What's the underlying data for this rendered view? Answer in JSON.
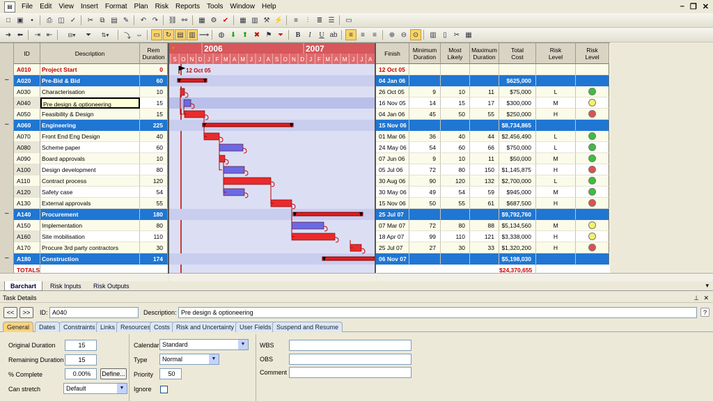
{
  "menu": [
    "File",
    "Edit",
    "View",
    "Insert",
    "Format",
    "Plan",
    "Risk",
    "Reports",
    "Tools",
    "Window",
    "Help"
  ],
  "grid_headers": {
    "id": "ID",
    "description": "Description",
    "rem_duration": "Rem\nDuration",
    "finish": "Finish",
    "min_duration": "Minimum\nDuration",
    "most_likely": "Most\nLikely",
    "max_duration": "Maximum\nDuration",
    "total_cost": "Total\nCost",
    "risk_level": "Risk\nLevel",
    "risk_level2": "Risk\nLevel"
  },
  "timeline": {
    "years": [
      "2006",
      "2007"
    ],
    "months": [
      "S",
      "O",
      "N",
      "D",
      "J",
      "F",
      "M",
      "A",
      "M",
      "J",
      "J",
      "A",
      "S",
      "O",
      "N",
      "D",
      "J",
      "F",
      "M",
      "A",
      "M",
      "J",
      "J",
      "A"
    ],
    "start_marker": "12 Oct 05"
  },
  "rows": [
    {
      "id": "A010",
      "desc": "Project Start",
      "dur": "0",
      "finish": "12 Oct 05",
      "min": "",
      "ml": "",
      "max": "",
      "cost": "",
      "risk": "",
      "dot": "",
      "type": "milestone"
    },
    {
      "id": "A020",
      "desc": "Pre-Bid & Bid",
      "dur": "60",
      "finish": "04 Jan 06",
      "min": "",
      "ml": "",
      "max": "",
      "cost": "$625,000",
      "risk": "",
      "dot": "",
      "type": "summary"
    },
    {
      "id": "A030",
      "desc": "Characterisation",
      "dur": "10",
      "finish": "26 Oct 05",
      "min": "9",
      "ml": "10",
      "max": "11",
      "cost": "$75,000",
      "risk": "L",
      "dot": "#3cbf3c",
      "type": "task"
    },
    {
      "id": "A040",
      "desc": "Pre design & optioneering",
      "dur": "15",
      "finish": "16 Nov 05",
      "min": "14",
      "ml": "15",
      "max": "17",
      "cost": "$300,000",
      "risk": "M",
      "dot": "#f2f26a",
      "type": "task"
    },
    {
      "id": "A050",
      "desc": "Feasibility & Design",
      "dur": "15",
      "finish": "04 Jan 06",
      "min": "45",
      "ml": "50",
      "max": "55",
      "cost": "$250,000",
      "risk": "H",
      "dot": "#e05050",
      "type": "task"
    },
    {
      "id": "A060",
      "desc": "Engineering",
      "dur": "225",
      "finish": "15 Nov 06",
      "min": "",
      "ml": "",
      "max": "",
      "cost": "$8,734,865",
      "risk": "",
      "dot": "",
      "type": "summary"
    },
    {
      "id": "A070",
      "desc": "Front End Eng Design",
      "dur": "40",
      "finish": "01 Mar 06",
      "min": "36",
      "ml": "40",
      "max": "44",
      "cost": "$2,456,490",
      "risk": "L",
      "dot": "#3cbf3c",
      "type": "task"
    },
    {
      "id": "A080",
      "desc": "Scheme paper",
      "dur": "60",
      "finish": "24 May 06",
      "min": "54",
      "ml": "60",
      "max": "66",
      "cost": "$750,000",
      "risk": "L",
      "dot": "#3cbf3c",
      "type": "task"
    },
    {
      "id": "A090",
      "desc": "Board approvals",
      "dur": "10",
      "finish": "07 Jun 06",
      "min": "9",
      "ml": "10",
      "max": "11",
      "cost": "$50,000",
      "risk": "M",
      "dot": "#3cbf3c",
      "type": "task"
    },
    {
      "id": "A100",
      "desc": "Design development",
      "dur": "80",
      "finish": "05 Jul 06",
      "min": "72",
      "ml": "80",
      "max": "150",
      "cost": "$1,145,875",
      "risk": "H",
      "dot": "#e05050",
      "type": "task"
    },
    {
      "id": "A110",
      "desc": "Contract process",
      "dur": "120",
      "finish": "30 Aug 06",
      "min": "90",
      "ml": "120",
      "max": "132",
      "cost": "$2,700,000",
      "risk": "L",
      "dot": "#3cbf3c",
      "type": "task"
    },
    {
      "id": "A120",
      "desc": "Safety case",
      "dur": "54",
      "finish": "30 May 06",
      "min": "49",
      "ml": "54",
      "max": "59",
      "cost": "$945,000",
      "risk": "M",
      "dot": "#3cbf3c",
      "type": "task"
    },
    {
      "id": "A130",
      "desc": "External approvals",
      "dur": "55",
      "finish": "15 Nov 06",
      "min": "50",
      "ml": "55",
      "max": "61",
      "cost": "$687,500",
      "risk": "H",
      "dot": "#e05050",
      "type": "task"
    },
    {
      "id": "A140",
      "desc": "Procurement",
      "dur": "180",
      "finish": "25 Jul 07",
      "min": "",
      "ml": "",
      "max": "",
      "cost": "$9,792,760",
      "risk": "",
      "dot": "",
      "type": "summary"
    },
    {
      "id": "A150",
      "desc": "Implementation",
      "dur": "80",
      "finish": "07 Mar 07",
      "min": "72",
      "ml": "80",
      "max": "88",
      "cost": "$5,134,560",
      "risk": "M",
      "dot": "#f2f26a",
      "type": "task"
    },
    {
      "id": "A160",
      "desc": "Site mobilisation",
      "dur": "110",
      "finish": "18 Apr 07",
      "min": "99",
      "ml": "110",
      "max": "121",
      "cost": "$3,338,000",
      "risk": "H",
      "dot": "#f2f26a",
      "type": "task"
    },
    {
      "id": "A170",
      "desc": "Procure 3rd party contractors",
      "dur": "30",
      "finish": "25 Jul 07",
      "min": "27",
      "ml": "30",
      "max": "33",
      "cost": "$1,320,200",
      "risk": "H",
      "dot": "#e05050",
      "type": "task"
    },
    {
      "id": "A180",
      "desc": "Construction",
      "dur": "174",
      "finish": "06 Nov 07",
      "min": "",
      "ml": "",
      "max": "",
      "cost": "$5,198,030",
      "risk": "",
      "dot": "",
      "type": "summary"
    }
  ],
  "totals": {
    "label": "TOTALS",
    "cost": "$24,370,655"
  },
  "sheet_tabs": [
    "Barchart",
    "Risk Inputs",
    "Risk Outputs"
  ],
  "panel": {
    "title": "Task Details",
    "nav_prev": "<<",
    "nav_next": ">>",
    "id_label": "ID:",
    "id_value": "A040",
    "desc_label": "Description:",
    "desc_value": "Pre design & optioneering",
    "tabs": [
      "General",
      "Dates",
      "Constraints",
      "Links",
      "Resources",
      "Costs",
      "Risk and Uncertainty",
      "User Fields",
      "Suspend and Resume"
    ],
    "orig_dur_label": "Original Duration",
    "orig_dur": "15",
    "rem_dur_label": "Remaining Duration",
    "rem_dur": "15",
    "pct_label": "% Complete",
    "pct": "0.00%",
    "define_btn": "Define...",
    "stretch_label": "Can stretch",
    "stretch": "Default",
    "calendar_label": "Calendar",
    "calendar": "Standard",
    "type_label": "Type",
    "type": "Normal",
    "priority_label": "Priority",
    "priority": "50",
    "ignore_label": "Ignore",
    "wbs_label": "WBS",
    "wbs": "",
    "obs_label": "OBS",
    "obs": "",
    "comment_label": "Comment",
    "comment": ""
  },
  "colors": {
    "summary": "#1f76d3",
    "bar": "#e21c1c",
    "bar_blue": "#6a6ae0",
    "gantt_bg": "#dcdff4"
  }
}
